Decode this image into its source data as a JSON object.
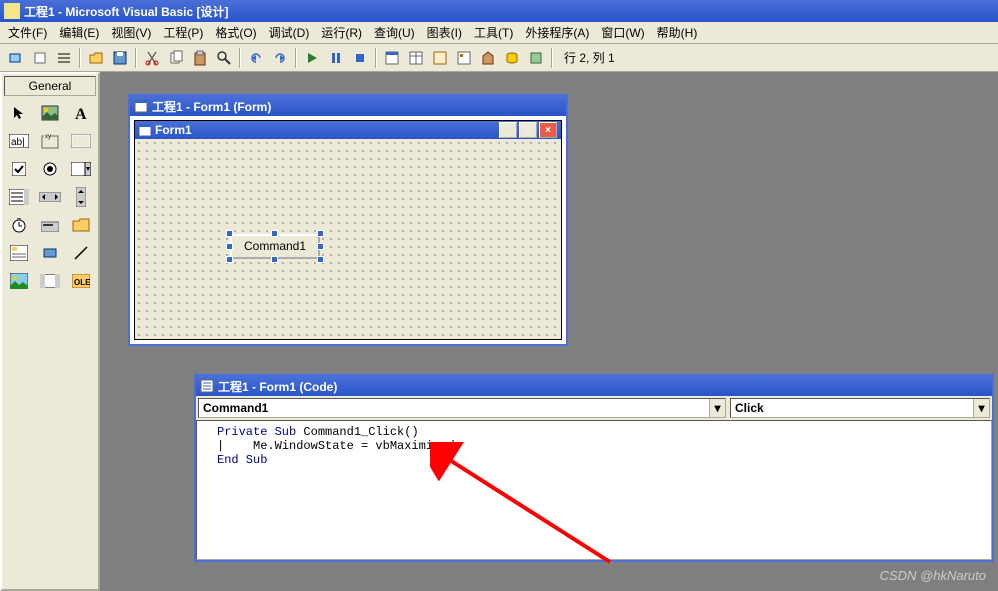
{
  "app": {
    "title": "工程1 - Microsoft Visual Basic [设计]"
  },
  "menus": [
    "文件(F)",
    "编辑(E)",
    "视图(V)",
    "工程(P)",
    "格式(O)",
    "调试(D)",
    "运行(R)",
    "查询(U)",
    "图表(I)",
    "工具(T)",
    "外接程序(A)",
    "窗口(W)",
    "帮助(H)"
  ],
  "toolbar": {
    "status": "行 2, 列 1"
  },
  "toolbox": {
    "title": "General"
  },
  "designer": {
    "title": "工程1 - Form1 (Form)",
    "form_caption": "Form1",
    "button_caption": "Command1"
  },
  "codewin": {
    "title": "工程1 - Form1 (Code)",
    "object": "Command1",
    "proc": "Click",
    "lines": {
      "l1a": "Private Sub ",
      "l1b": "Command1_Click()",
      "l2": "    Me.WindowState = vbMaximized",
      "l3": "End Sub"
    }
  },
  "watermark": "CSDN @hkNaruto"
}
